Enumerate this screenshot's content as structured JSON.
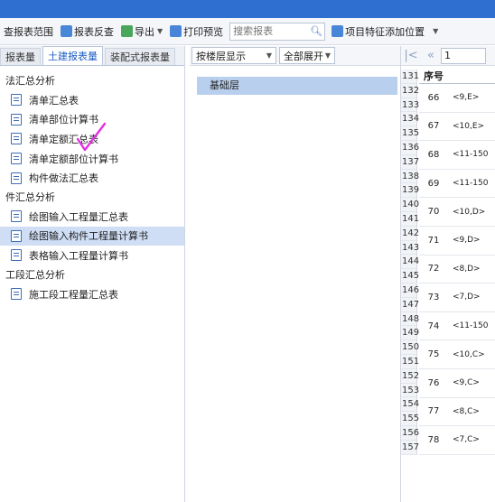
{
  "toolbar": {
    "range": "查报表范围",
    "reverse": "报表反查",
    "export": "导出",
    "print_preview": "打印预览",
    "search_placeholder": "搜索报表",
    "add_feature_position": "项目特征添加位置"
  },
  "tabs": [
    {
      "label": "报表量",
      "active": false
    },
    {
      "label": "土建报表量",
      "active": true
    },
    {
      "label": "装配式报表量",
      "active": false
    }
  ],
  "tree": {
    "group1": "法汇总分析",
    "group1_items": [
      "清单汇总表",
      "清单部位计算书",
      "清单定额汇总表",
      "清单定额部位计算书",
      "构件做法汇总表"
    ],
    "group2": "件汇总分析",
    "group2_items": [
      "绘图输入工程量汇总表",
      "绘图输入构件工程量计算书",
      "表格输入工程量计算书"
    ],
    "group3": "工段汇总分析",
    "group3_items": [
      "施工段工程量汇总表"
    ]
  },
  "middle": {
    "display_mode": "按楼层显示",
    "expand_mode": "全部展开",
    "floor": "基础层"
  },
  "right": {
    "page_value": "1",
    "header_index": "序号",
    "row_numbers": [
      "131",
      "132",
      "133",
      "134",
      "135",
      "136",
      "137",
      "138",
      "139",
      "140",
      "141",
      "142",
      "143",
      "144",
      "145",
      "146",
      "147",
      "148",
      "149",
      "150",
      "151",
      "152",
      "153",
      "154",
      "155",
      "156",
      "157"
    ],
    "rows": [
      {
        "idx": "66",
        "loc": "<9,E>"
      },
      {
        "idx": "67",
        "loc": "<10,E>"
      },
      {
        "idx": "68",
        "loc": "<11-150"
      },
      {
        "idx": "69",
        "loc": "<11-150"
      },
      {
        "idx": "70",
        "loc": "<10,D>"
      },
      {
        "idx": "71",
        "loc": "<9,D>"
      },
      {
        "idx": "72",
        "loc": "<8,D>"
      },
      {
        "idx": "73",
        "loc": "<7,D>"
      },
      {
        "idx": "74",
        "loc": "<11-150"
      },
      {
        "idx": "75",
        "loc": "<10,C>"
      },
      {
        "idx": "76",
        "loc": "<9,C>"
      },
      {
        "idx": "77",
        "loc": "<8,C>"
      },
      {
        "idx": "78",
        "loc": "<7,C>"
      }
    ]
  },
  "colors": {
    "titlebar": "#2e6fd0",
    "selected": "#cfdef5",
    "floor_highlight": "#b9cfee",
    "annotation": "#e62fe0"
  }
}
